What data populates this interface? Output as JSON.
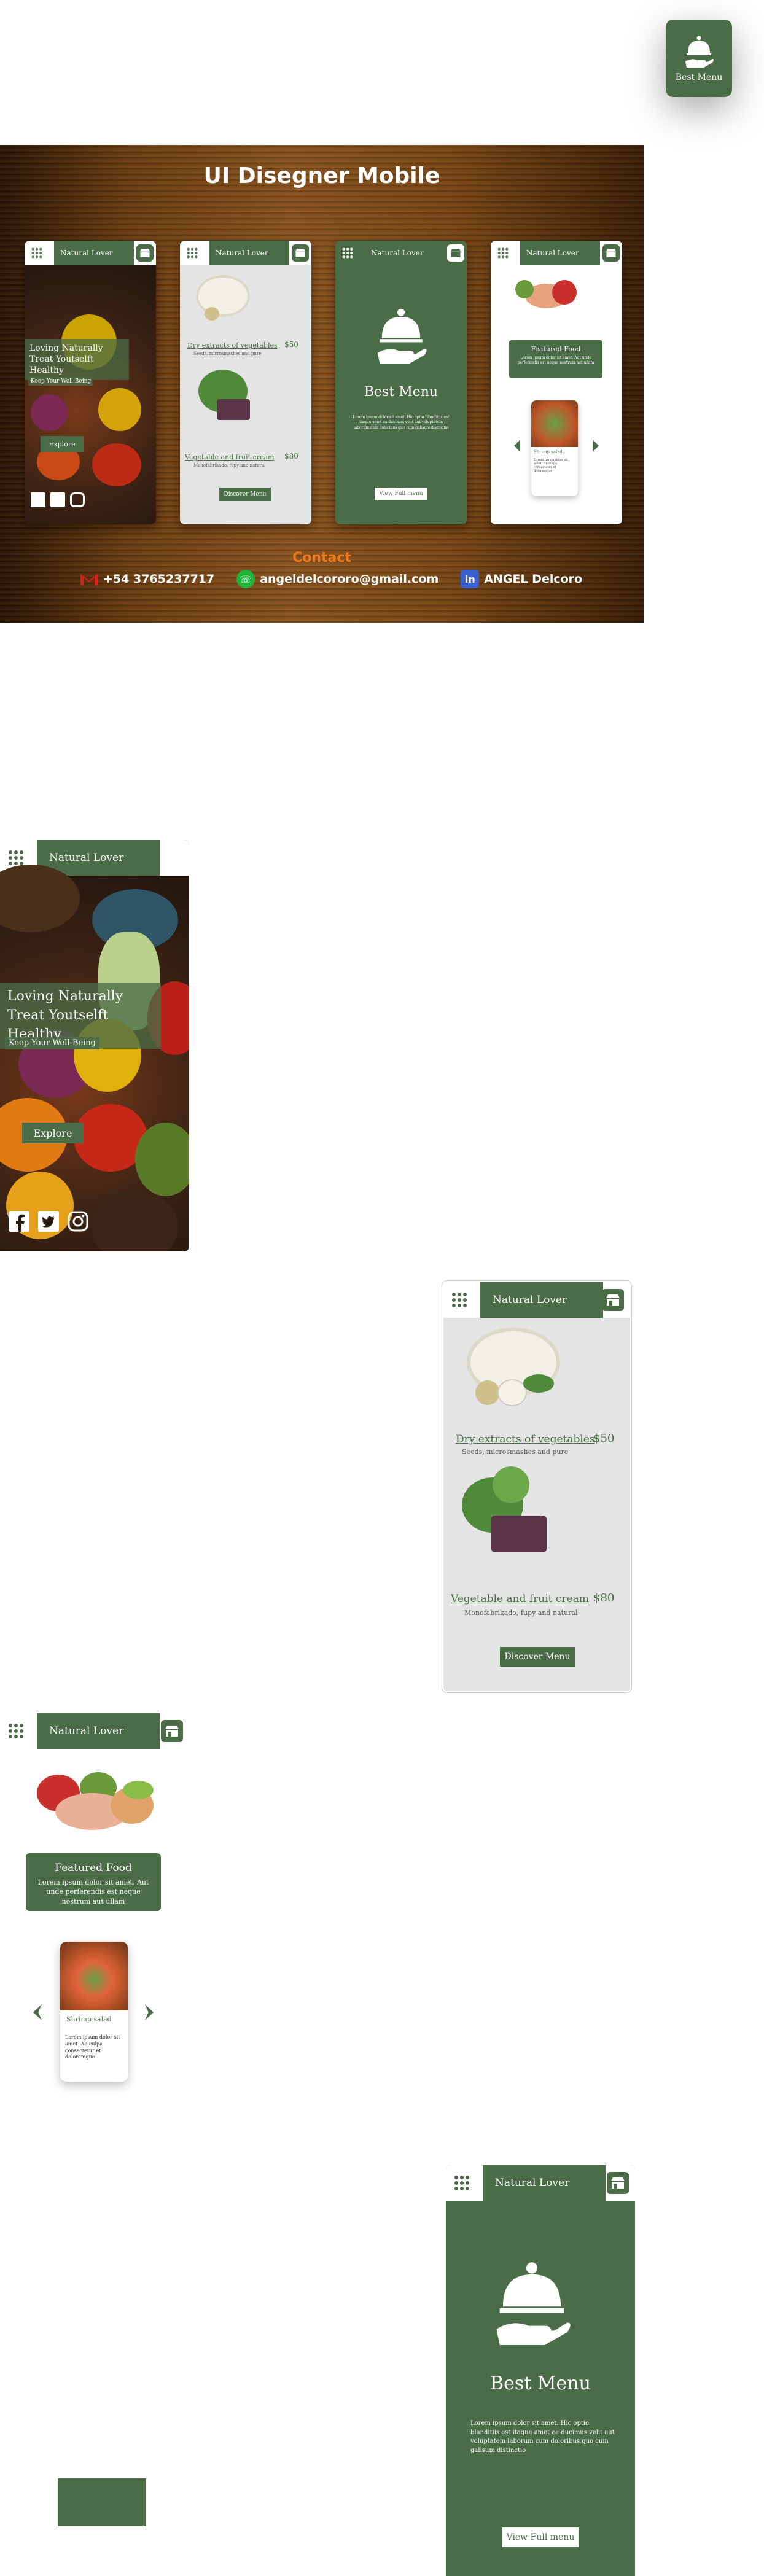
{
  "brand": "Natural Lover",
  "colors": {
    "primary": "#4a6c46",
    "accent": "#f07a1a",
    "wood": "#6b3e12"
  },
  "float_card": {
    "label": "Best Menu",
    "icon": "cloche-hand-icon"
  },
  "banner": {
    "title": "UI Disegner Mobile",
    "contact_title": "Contact",
    "contacts": [
      {
        "icon": "gmail-icon",
        "text": "+54 3765237717"
      },
      {
        "icon": "whatsapp-icon",
        "text": "angeldelcororo@gmail.com"
      },
      {
        "icon": "linkedin-icon",
        "text": "ANGEL Delcoro"
      }
    ]
  },
  "home": {
    "headline_1": "Loving Naturally",
    "headline_2": "Treat Youtselft Healthy",
    "tagline": "Keep Your Well-Being",
    "cta": "Explore",
    "social": [
      "facebook-icon",
      "twitter-icon",
      "instagram-icon"
    ]
  },
  "menu": {
    "items": [
      {
        "name": "Dry extracts of vegetables",
        "desc": "Seeds, microsmashes and pure",
        "price": "$50"
      },
      {
        "name": "Vegetable and fruit cream",
        "desc": "Monofabrikado, fupy and natural",
        "price": "$80"
      }
    ],
    "cta": "Discover Menu"
  },
  "featured": {
    "title": "Featured Food",
    "text": "Lorem ipsum dolor sit amet. Aut unde perferendis est neque nostrum aut ullam",
    "card_title": "Shrimp salad",
    "card_text": "Lorem ipsum dolor sit amet. Ab culpa consectetur et doloremque"
  },
  "best_menu": {
    "title": "Best Menu",
    "text": "Lorem ipsum dolor sit amet. Hic optio blanditiis est itaque amet ea ducimus velit aut voluptatem laborum cum doloribus quo cum galisum distinctio",
    "cta": "View Full menu"
  }
}
